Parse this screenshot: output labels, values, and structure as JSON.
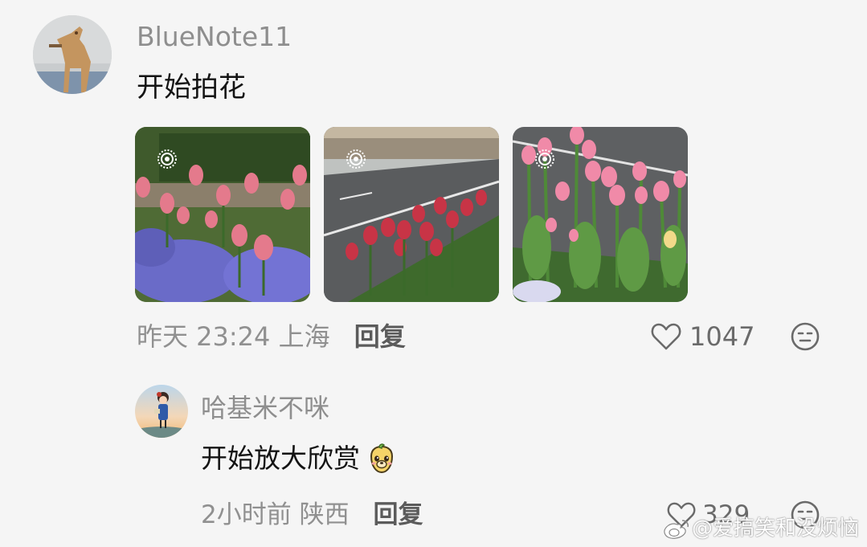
{
  "comment": {
    "username": "BlueNote11",
    "text": "开始拍花",
    "time": "昨天 23:24",
    "location": "上海",
    "reply_label": "回复",
    "likes": "1047",
    "photos": [
      {
        "name": "tulips-with-pansies",
        "live": true
      },
      {
        "name": "tulips-by-street",
        "live": true
      },
      {
        "name": "pink-tulips-roadside",
        "live": true
      }
    ]
  },
  "reply": {
    "username": "哈基米不咪",
    "text": "开始放大欣赏",
    "sticker_icon": "cute-face-sticker",
    "time": "2小时前",
    "location": "陕西",
    "reply_label": "回复",
    "likes": "329"
  },
  "watermark": {
    "text": "@爱搞笑和没烦恼",
    "icon": "weibo-logo-icon"
  },
  "colors": {
    "background": "#f5f5f5",
    "username": "#8e8e8e",
    "meta": "#909090"
  }
}
